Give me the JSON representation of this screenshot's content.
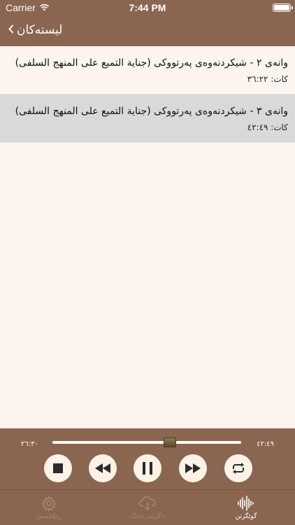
{
  "status_bar": {
    "carrier": "Carrier",
    "time": "7:44 PM"
  },
  "nav": {
    "back_label": "لیستەکان",
    "back_icon": "chevron-left-icon"
  },
  "list": {
    "items": [
      {
        "title": "وانەی ٢ - شیکردنەوەی پەرتووکی (جناية التميع على المنهج السلفى)",
        "duration": "کات: ٣٦:٢٢",
        "selected": false
      },
      {
        "title": "وانەی ٣ - شیکردنەوەی پەرتووکی (جناية التميع على المنهج السلفى)",
        "duration": "کات: ٤٢:٤٩",
        "selected": true
      }
    ]
  },
  "player": {
    "elapsed": "٢٦:٣٠",
    "total": "٤٢:٤٩",
    "progress": 0.624,
    "buttons": [
      "stop-icon",
      "rewind-icon",
      "pause-icon",
      "fast-forward-icon",
      "repeat-icon"
    ]
  },
  "tabs": [
    {
      "label": "ڕێکخستن",
      "icon": "gear-icon",
      "active": false
    },
    {
      "label": "داگرتنی دەنگ",
      "icon": "cloud-download-icon",
      "active": false
    },
    {
      "label": "گوێگرتن",
      "icon": "waveform-icon",
      "active": true
    }
  ],
  "colors": {
    "primary": "#8a6550",
    "background": "#fdf4ef",
    "selected_row": "#d9d9d9",
    "button_bg": "#fcf2e6"
  }
}
